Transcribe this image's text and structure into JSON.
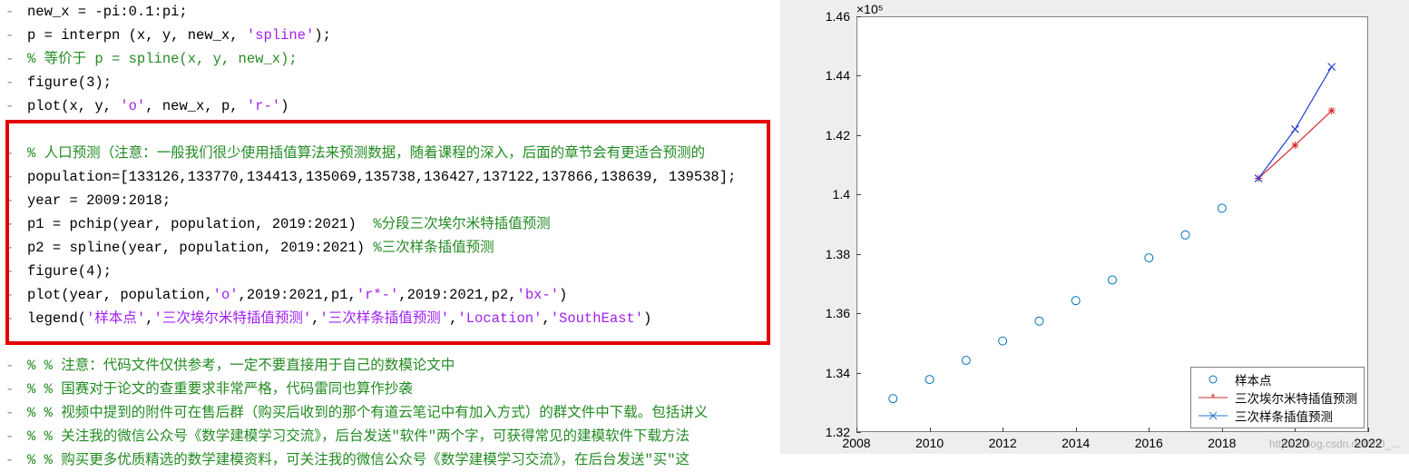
{
  "code": {
    "l0": "new_x = -pi:0.1:pi;",
    "l1_a": "p = interpn (x, y, new_x, ",
    "l1_str": "'spline'",
    "l1_b": ");",
    "l2_com": "% 等价于 p = spline(x, y, new_x);",
    "l3": "figure(3);",
    "l4_a": "plot(x, y, ",
    "l4_s1": "'o'",
    "l4_b": ", new_x, p, ",
    "l4_s2": "'r-'",
    "l4_c": ")",
    "l5_com": "% 人口预测（注意：一般我们很少使用插值算法来预测数据，随着课程的深入，后面的章节会有更适合预测的",
    "l6": "population=[133126,133770,134413,135069,135738,136427,137122,137866,138639, 139538];",
    "l7": "year = 2009:2018;",
    "l8_a": "p1 = pchip(year, population, 2019:2021)  ",
    "l8_com": "%分段三次埃尔米特插值预测",
    "l9_a": "p2 = spline(year, population, 2019:2021) ",
    "l9_com": "%三次样条插值预测",
    "l10": "figure(4);",
    "l11_a": "plot(year, population,",
    "l11_s1": "'o'",
    "l11_b": ",2019:2021,p1,",
    "l11_s2": "'r*-'",
    "l11_c": ",2019:2021,p2,",
    "l11_s3": "'bx-'",
    "l11_d": ")",
    "l12_a": "legend(",
    "l12_s1": "'样本点'",
    "l12_b": ",",
    "l12_s2": "'三次埃尔米特插值预测'",
    "l12_c": ",",
    "l12_s3": "'三次样条插值预测'",
    "l12_d": ",",
    "l12_s4": "'Location'",
    "l12_e": ",",
    "l12_s5": "'SouthEast'",
    "l12_f": ")",
    "l13_com": "% % 注意：代码文件仅供参考，一定不要直接用于自己的数模论文中",
    "l14_com": "% % 国赛对于论文的查重要求非常严格，代码雷同也算作抄袭",
    "l15_com": "% % 视频中提到的附件可在售后群（购买后收到的那个有道云笔记中有加入方式）的群文件中下载。包括讲义",
    "l16_com": "% % 关注我的微信公众号《数学建模学习交流》，后台发送\"软件\"两个字，可获得常见的建模软件下载方法",
    "l17_com": "% % 购买更多优质精选的数学建模资料，可关注我的微信公众号《数学建模学习交流》，在后台发送\"买\"这"
  },
  "chart_data": {
    "type": "scatter+line",
    "exp_label": "×10⁵",
    "year": [
      2009,
      2010,
      2011,
      2012,
      2013,
      2014,
      2015,
      2016,
      2017,
      2018
    ],
    "population": [
      133126,
      133770,
      134413,
      135069,
      135738,
      136427,
      137122,
      137866,
      138639,
      139538
    ],
    "pred_year": [
      2019,
      2020,
      2021
    ],
    "p1_hermite": [
      140546,
      141660,
      142820
    ],
    "p2_spline": [
      140546,
      142200,
      144300
    ],
    "xlim": [
      2008,
      2022
    ],
    "ylim": [
      132000,
      146000
    ],
    "xticks": [
      2008,
      2010,
      2012,
      2014,
      2016,
      2018,
      2020,
      2022
    ],
    "yticks": [
      1.32,
      1.34,
      1.36,
      1.38,
      1.4,
      1.42,
      1.44,
      1.46
    ],
    "legend": {
      "loc": "SouthEast",
      "items": [
        "样本点",
        "三次埃尔米特插值预测",
        "三次样条插值预测"
      ]
    }
  },
  "watermark": "https://blog.csdn.net/m0_..."
}
